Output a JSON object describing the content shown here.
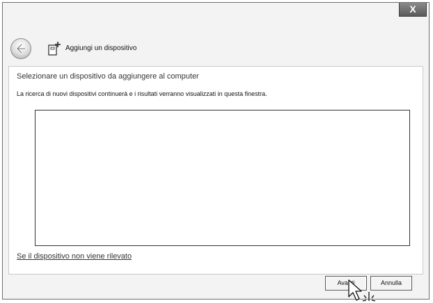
{
  "window": {
    "close_label": "X"
  },
  "header": {
    "title": "Aggiungi un dispositivo"
  },
  "content": {
    "instruction": "Selezionare un dispositivo da aggiungere al computer",
    "status": "La ricerca di nuovi dispositivi continuerà e i risultati verranno visualizzati in questa finestra.",
    "help_link": "Se il dispositivo non viene rilevato"
  },
  "footer": {
    "next_label": "Avanti",
    "cancel_label": "Annulla"
  },
  "icons": {
    "back": "back-arrow-icon",
    "wizard": "add-device-icon",
    "cursor": "mouse-pointer-icon"
  }
}
